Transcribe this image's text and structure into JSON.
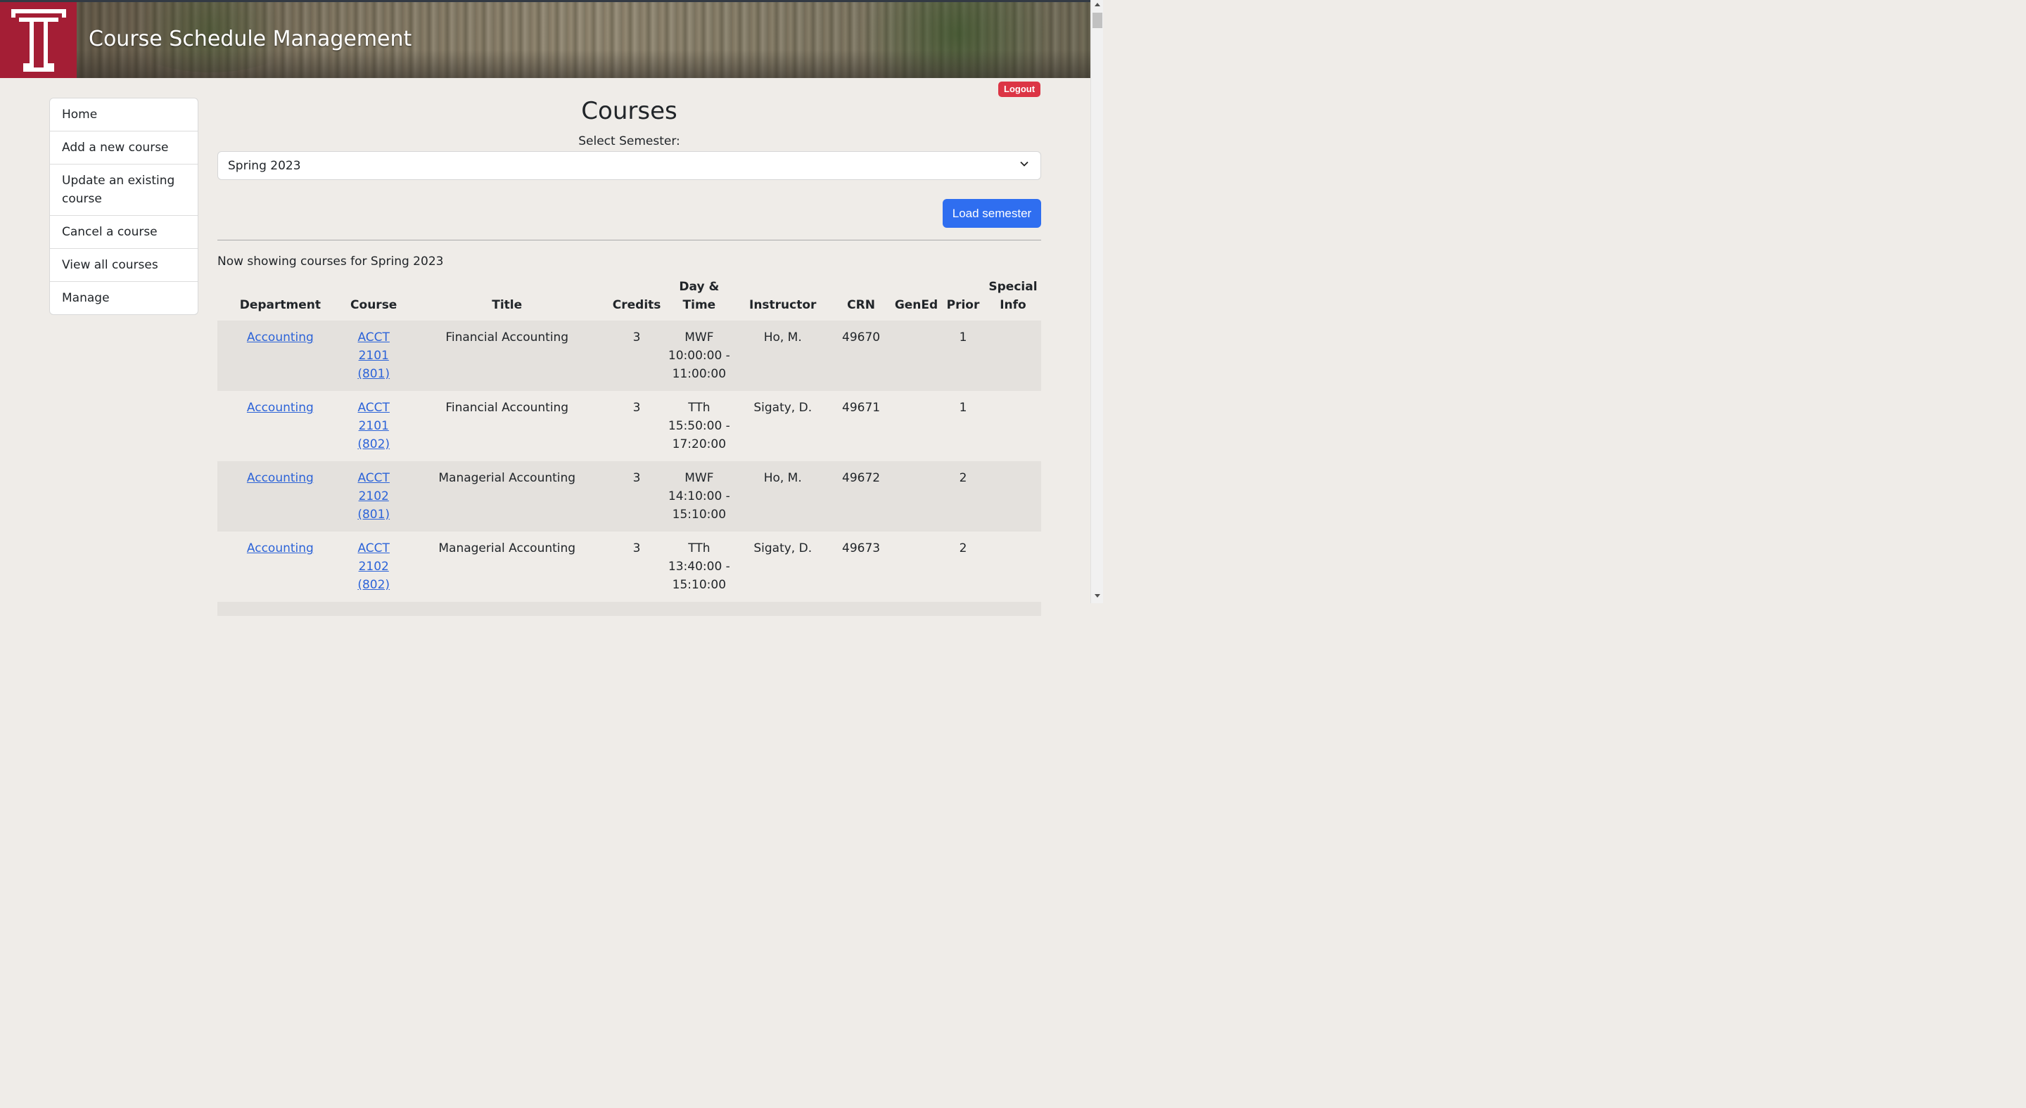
{
  "header": {
    "title": "Course Schedule Management"
  },
  "logout_label": "Logout",
  "sidebar": {
    "items": [
      {
        "label": "Home"
      },
      {
        "label": "Add a new course"
      },
      {
        "label": "Update an existing course"
      },
      {
        "label": "Cancel a course"
      },
      {
        "label": "View all courses"
      },
      {
        "label": "Manage"
      }
    ]
  },
  "main": {
    "title": "Courses",
    "select_label": "Select Semester:",
    "select_value": "Spring 2023",
    "load_button": "Load semester",
    "showing_text": "Now showing courses for Spring 2023"
  },
  "table": {
    "headers": {
      "department": "Department",
      "course": "Course",
      "title": "Title",
      "credits": "Credits",
      "daytime_1": "Day &",
      "daytime_2": "Time",
      "instructor": "Instructor",
      "crn": "CRN",
      "gened": "GenEd",
      "prior": "Prior",
      "special_1": "Special",
      "special_2": "Info"
    },
    "rows": [
      {
        "department": "Accounting",
        "course_1": "ACCT",
        "course_2": "2101",
        "course_3": "(801)",
        "title": "Financial Accounting",
        "credits": "3",
        "day": "MWF",
        "time_1": "10:00:00 -",
        "time_2": "11:00:00",
        "instructor": "Ho, M.",
        "crn": "49670",
        "gened": "",
        "prior": "1",
        "special": ""
      },
      {
        "department": "Accounting",
        "course_1": "ACCT",
        "course_2": "2101",
        "course_3": "(802)",
        "title": "Financial Accounting",
        "credits": "3",
        "day": "TTh",
        "time_1": "15:50:00 -",
        "time_2": "17:20:00",
        "instructor": "Sigaty, D.",
        "crn": "49671",
        "gened": "",
        "prior": "1",
        "special": ""
      },
      {
        "department": "Accounting",
        "course_1": "ACCT",
        "course_2": "2102",
        "course_3": "(801)",
        "title": "Managerial Accounting",
        "credits": "3",
        "day": "MWF",
        "time_1": "14:10:00 -",
        "time_2": "15:10:00",
        "instructor": "Ho, M.",
        "crn": "49672",
        "gened": "",
        "prior": "2",
        "special": ""
      },
      {
        "department": "Accounting",
        "course_1": "ACCT",
        "course_2": "2102",
        "course_3": "(802)",
        "title": "Managerial Accounting",
        "credits": "3",
        "day": "TTh",
        "time_1": "13:40:00 -",
        "time_2": "15:10:00",
        "instructor": "Sigaty, D.",
        "crn": "49673",
        "gened": "",
        "prior": "2",
        "special": ""
      }
    ]
  }
}
